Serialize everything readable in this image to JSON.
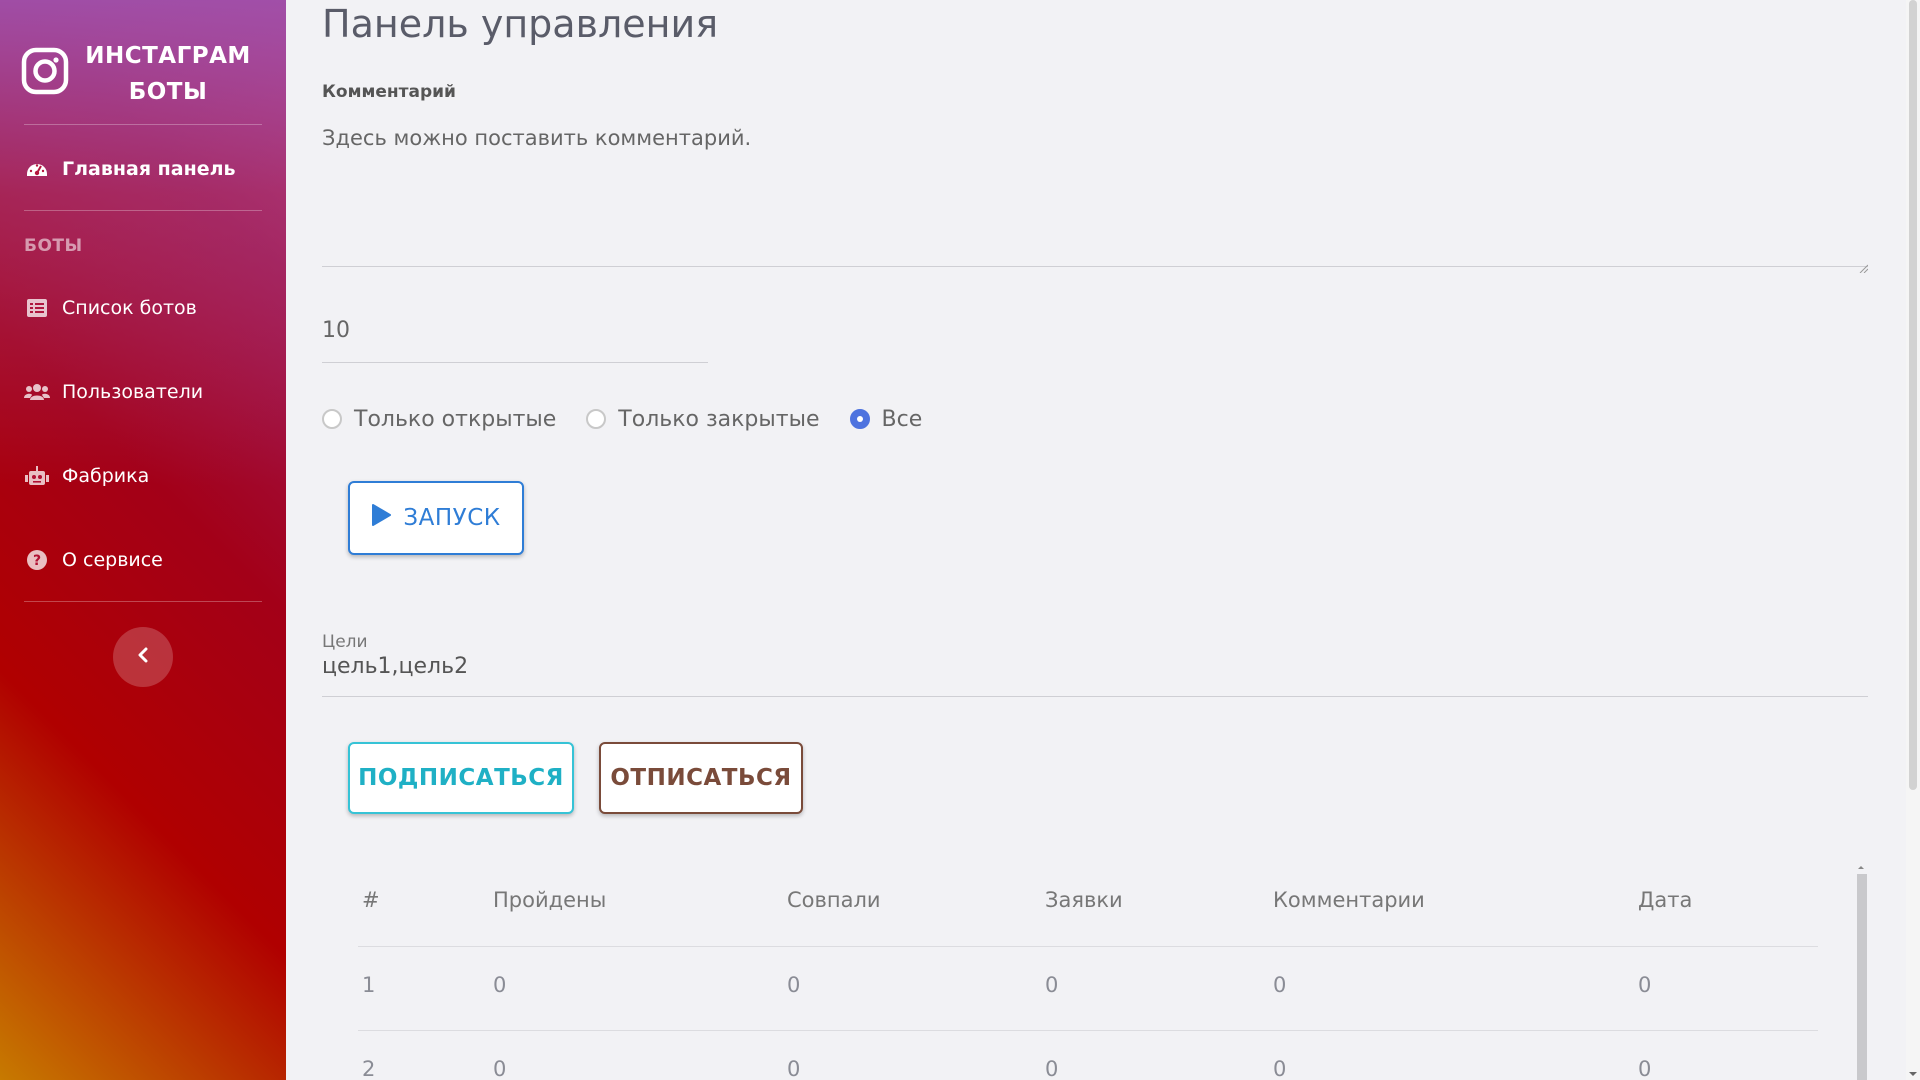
{
  "brand": {
    "line1": "ИНСТАГРАМ",
    "line2": "БОТЫ",
    "icon": "instagram-icon"
  },
  "sidebar": {
    "dashboard": {
      "label": "Главная панель",
      "icon": "dashboard-gauge-icon"
    },
    "section_title": "БОТЫ",
    "items": [
      {
        "label": "Список ботов",
        "icon": "list-icon"
      },
      {
        "label": "Пользователи",
        "icon": "users-icon"
      },
      {
        "label": "Фабрика",
        "icon": "robot-icon"
      },
      {
        "label": "О сервисе",
        "icon": "question-circle-icon"
      }
    ],
    "toggle_icon": "chevron-left-icon"
  },
  "main": {
    "title": "Панель управления",
    "comment": {
      "label": "Комментарий",
      "value": "Здесь можно поставить комментарий."
    },
    "count_value": "10",
    "radios": [
      {
        "label": "Только открытые",
        "checked": false
      },
      {
        "label": "Только закрытые",
        "checked": false
      },
      {
        "label": "Все",
        "checked": true
      }
    ],
    "run_button": {
      "label": "ЗАПУСК",
      "icon": "play-icon"
    },
    "goals": {
      "label": "Цели",
      "value": "цель1,цель2"
    },
    "subscribe_button": "ПОДПИСАТЬСЯ",
    "unsubscribe_button": "ОТПИСАТЬСЯ",
    "table": {
      "headers": [
        "#",
        "Пройдены",
        "Совпали",
        "Заявки",
        "Комментарии",
        "Дата"
      ],
      "rows": [
        [
          "1",
          "0",
          "0",
          "0",
          "0",
          "0"
        ],
        [
          "2",
          "0",
          "0",
          "0",
          "0",
          "0"
        ]
      ]
    }
  },
  "colors": {
    "primary": "#2f7dd6",
    "info": "#36c3d6",
    "brown": "#7a4b3a",
    "radio_checked": "#4e73df"
  }
}
